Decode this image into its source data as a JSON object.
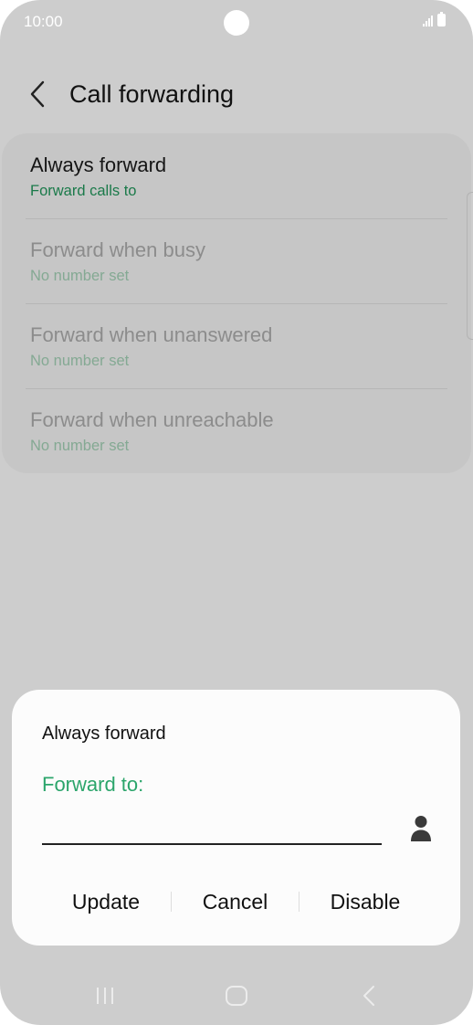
{
  "status_bar": {
    "time": "10:00",
    "icons": [
      "signal-icon",
      "battery-icon"
    ]
  },
  "header": {
    "title": "Call forwarding",
    "back_icon": "chevron-left-icon"
  },
  "forward_options": [
    {
      "label": "Always forward",
      "sub": "Forward calls to"
    },
    {
      "label": "Forward when busy",
      "sub": "No number set"
    },
    {
      "label": "Forward when unanswered",
      "sub": "No number set"
    },
    {
      "label": "Forward when unreachable",
      "sub": "No number set"
    }
  ],
  "dialog": {
    "title": "Always forward",
    "field_label": "Forward to:",
    "input_value": "",
    "contact_icon": "person-icon",
    "buttons": {
      "update": "Update",
      "cancel": "Cancel",
      "disable": "Disable"
    }
  },
  "nav_bar": {
    "icons": [
      "recent-apps-icon",
      "home-icon",
      "back-icon"
    ]
  },
  "colors": {
    "accent_green": "#2ba56b",
    "subtitle_green": "#1b7a4a",
    "background": "#cdcdcd",
    "dialog_background": "#fcfcfc"
  }
}
